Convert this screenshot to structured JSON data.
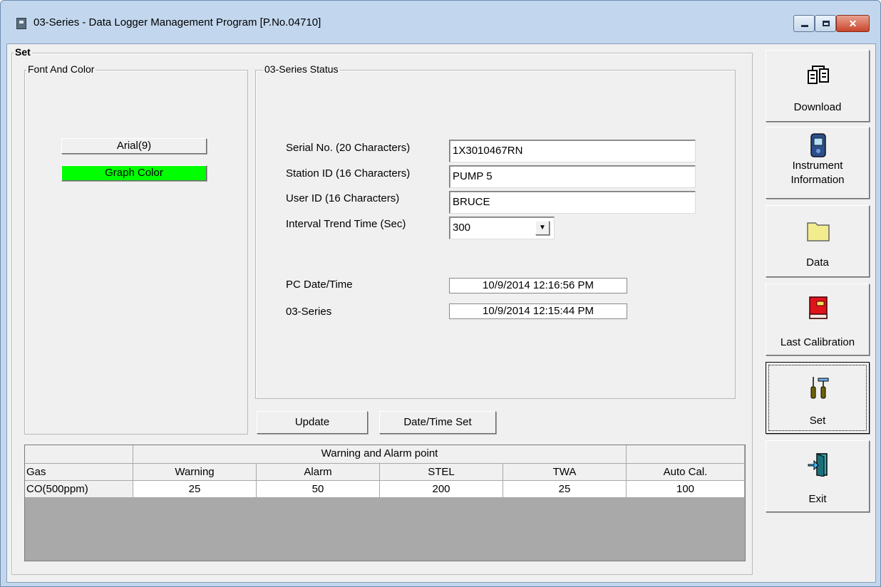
{
  "window": {
    "title": "03-Series  - Data Logger Management Program [P.No.04710]",
    "controls": {
      "minimize": "–",
      "maximize": "□",
      "close": "✕"
    }
  },
  "set_group": {
    "label": "Set"
  },
  "font_color_group": {
    "label": "Font And Color",
    "font_button": "Arial(9)",
    "graph_color_button": "Graph Color",
    "graph_color": "#00ff00"
  },
  "status_group": {
    "label": "03-Series Status",
    "serial_label": "Serial No. (20 Characters)",
    "serial_value": "1X3010467RN",
    "station_label": "Station ID (16 Characters)",
    "station_value": "PUMP 5",
    "user_label": "User ID (16 Characters)",
    "user_value": "BRUCE",
    "interval_label": "Interval Trend Time (Sec)",
    "interval_value": "300",
    "pc_datetime_label": "PC Date/Time",
    "pc_datetime_value": "10/9/2014 12:16:56 PM",
    "device_datetime_label": "03-Series",
    "device_datetime_value": "10/9/2014 12:15:44 PM"
  },
  "actions": {
    "update": "Update",
    "datetime_set": "Date/Time Set"
  },
  "grid": {
    "group_header": "Warning and Alarm point",
    "columns": [
      "Gas",
      "Warning",
      "Alarm",
      "STEL",
      "TWA",
      "Auto Cal."
    ],
    "rows": [
      [
        "CO(500ppm)",
        "25",
        "50",
        "200",
        "25",
        "100"
      ]
    ]
  },
  "sidebar": {
    "download": "Download",
    "instrument_line1": "Instrument",
    "instrument_line2": "Information",
    "data": "Data",
    "last_calibration": "Last Calibration",
    "set": "Set",
    "exit": "Exit"
  }
}
